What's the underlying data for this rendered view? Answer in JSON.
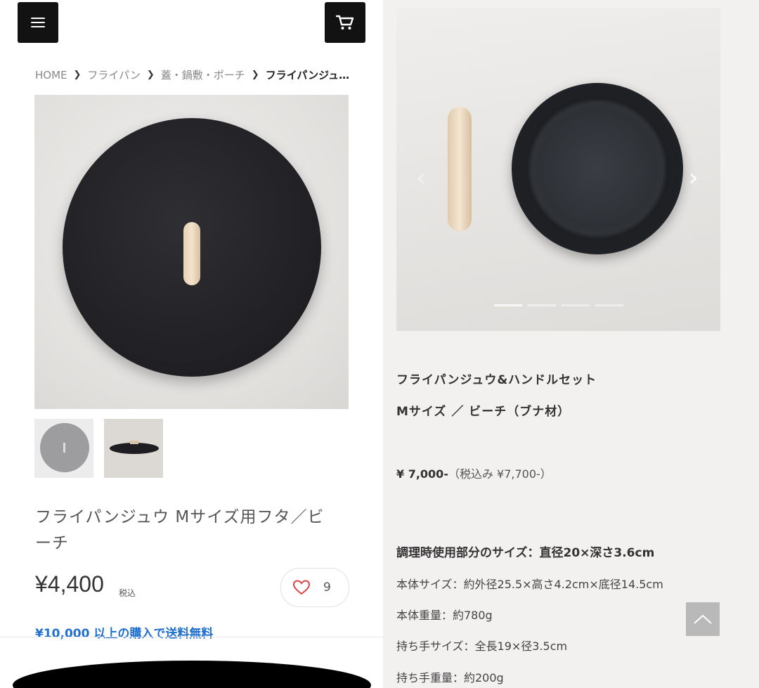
{
  "left": {
    "breadcrumb": [
      "HOME",
      "フライパン",
      "蓋・鍋敷・ポーチ",
      "フライパンジュ…"
    ],
    "product_title": "フライパンジュウ Mサイズ用フタ／ビーチ",
    "price": "¥4,400",
    "tax_label": "税込",
    "favorite_count": "9",
    "free_shipping": "¥10,000 以上の購入で送料無料"
  },
  "right": {
    "name_line1": "フライパンジュウ&ハンドルセット",
    "name_line2": "Mサイズ ／ ビーチ（ブナ材）",
    "price": "¥ 7,000-",
    "price_incl": "（税込み ¥7,700-）",
    "spec_heading": "調理時使用部分のサイズ：直径20×深さ3.6cm",
    "specs": [
      "本体サイズ：約外径25.5×高さ4.2cm×底径14.5cm",
      "本体重量：約780g",
      "持ち手サイズ：全長19×径3.5cm",
      "持ち手重量：約200g"
    ],
    "slides_total": 4,
    "slide_active": 1
  },
  "icons": {
    "menu": "hamburger-menu-icon",
    "cart": "shopping-cart-icon",
    "heart": "heart-icon",
    "prev": "chevron-left-icon",
    "next": "chevron-right-icon",
    "top": "chevron-up-icon"
  },
  "colors": {
    "link_blue": "#1f6fd0",
    "heart_red": "#d84545",
    "button_dark": "#121212"
  }
}
